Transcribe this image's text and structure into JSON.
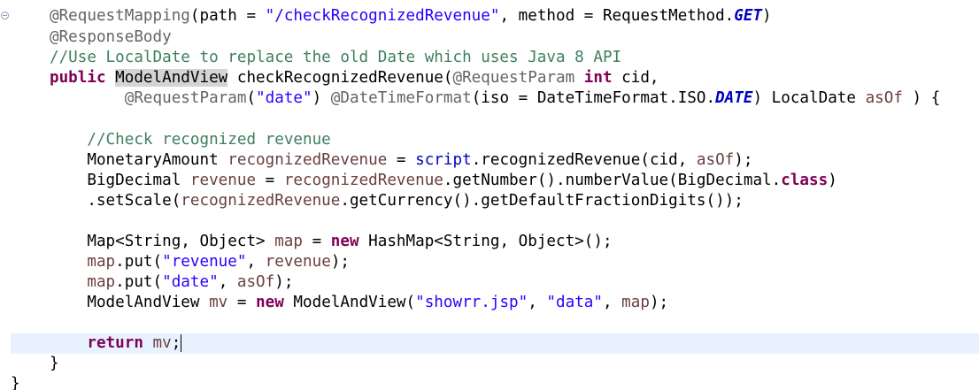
{
  "editor": {
    "language": "java",
    "current_line_index": 16,
    "lines": [
      [
        {
          "t": "@RequestMapping",
          "c": "ann"
        },
        {
          "t": "(path = ",
          "c": "sem"
        },
        {
          "t": "\"/checkRecognizedRevenue\"",
          "c": "str"
        },
        {
          "t": ", method = RequestMethod.",
          "c": "sem"
        },
        {
          "t": "GET",
          "c": "const"
        },
        {
          "t": ")",
          "c": "sem"
        }
      ],
      [
        {
          "t": "@ResponseBody",
          "c": "ann"
        }
      ],
      [
        {
          "t": "//Use LocalDate to replace the old Date which uses Java 8 API",
          "c": "cmt"
        }
      ],
      [
        {
          "t": "public",
          "c": "kw"
        },
        {
          "t": " ",
          "c": "sem"
        },
        {
          "t": "ModelAndView",
          "c": "hl"
        },
        {
          "t": " checkRecognizedRevenue(",
          "c": "sem"
        },
        {
          "t": "@RequestParam",
          "c": "ann"
        },
        {
          "t": " ",
          "c": "sem"
        },
        {
          "t": "int",
          "c": "kw"
        },
        {
          "t": " cid,",
          "c": "sem"
        }
      ],
      [
        {
          "t": "        ",
          "c": "sem"
        },
        {
          "t": "@RequestParam",
          "c": "ann"
        },
        {
          "t": "(",
          "c": "sem"
        },
        {
          "t": "\"date\"",
          "c": "str"
        },
        {
          "t": ") ",
          "c": "sem"
        },
        {
          "t": "@DateTimeFormat",
          "c": "ann"
        },
        {
          "t": "(iso = DateTimeFormat.ISO.",
          "c": "sem"
        },
        {
          "t": "DATE",
          "c": "const"
        },
        {
          "t": ") LocalDate ",
          "c": "sem"
        },
        {
          "t": "asOf",
          "c": "var"
        },
        {
          "t": " ) {",
          "c": "sem"
        }
      ],
      [],
      [
        {
          "t": "    ",
          "c": "sem"
        },
        {
          "t": "//Check recognized revenue",
          "c": "cmt"
        }
      ],
      [
        {
          "t": "    MonetaryAmount ",
          "c": "sem"
        },
        {
          "t": "recognizedRevenue",
          "c": "var"
        },
        {
          "t": " = ",
          "c": "sem"
        },
        {
          "t": "script",
          "c": "fld"
        },
        {
          "t": ".recognizedRevenue(cid, ",
          "c": "sem"
        },
        {
          "t": "asOf",
          "c": "var"
        },
        {
          "t": ");",
          "c": "sem"
        }
      ],
      [
        {
          "t": "    BigDecimal ",
          "c": "sem"
        },
        {
          "t": "revenue",
          "c": "var"
        },
        {
          "t": " = ",
          "c": "sem"
        },
        {
          "t": "recognizedRevenue",
          "c": "var"
        },
        {
          "t": ".getNumber().numberValue(BigDecimal.",
          "c": "sem"
        },
        {
          "t": "class",
          "c": "kw"
        },
        {
          "t": ")",
          "c": "sem"
        }
      ],
      [
        {
          "t": "    .setScale(",
          "c": "sem"
        },
        {
          "t": "recognizedRevenue",
          "c": "var"
        },
        {
          "t": ".getCurrency().getDefaultFractionDigits());",
          "c": "sem"
        }
      ],
      [],
      [
        {
          "t": "    Map<String, Object> ",
          "c": "sem"
        },
        {
          "t": "map",
          "c": "var"
        },
        {
          "t": " = ",
          "c": "sem"
        },
        {
          "t": "new",
          "c": "kw"
        },
        {
          "t": " HashMap<String, Object>();",
          "c": "sem"
        }
      ],
      [
        {
          "t": "    ",
          "c": "sem"
        },
        {
          "t": "map",
          "c": "var"
        },
        {
          "t": ".put(",
          "c": "sem"
        },
        {
          "t": "\"revenue\"",
          "c": "str"
        },
        {
          "t": ", ",
          "c": "sem"
        },
        {
          "t": "revenue",
          "c": "var"
        },
        {
          "t": ");",
          "c": "sem"
        }
      ],
      [
        {
          "t": "    ",
          "c": "sem"
        },
        {
          "t": "map",
          "c": "var"
        },
        {
          "t": ".put(",
          "c": "sem"
        },
        {
          "t": "\"date\"",
          "c": "str"
        },
        {
          "t": ", ",
          "c": "sem"
        },
        {
          "t": "asOf",
          "c": "var"
        },
        {
          "t": ");",
          "c": "sem"
        }
      ],
      [
        {
          "t": "    ModelAndView ",
          "c": "sem"
        },
        {
          "t": "mv",
          "c": "var"
        },
        {
          "t": " = ",
          "c": "sem"
        },
        {
          "t": "new",
          "c": "kw"
        },
        {
          "t": " ModelAndView(",
          "c": "sem"
        },
        {
          "t": "\"showrr.jsp\"",
          "c": "str"
        },
        {
          "t": ", ",
          "c": "sem"
        },
        {
          "t": "\"data\"",
          "c": "str"
        },
        {
          "t": ", ",
          "c": "sem"
        },
        {
          "t": "map",
          "c": "var"
        },
        {
          "t": ");",
          "c": "sem"
        }
      ],
      [],
      [
        {
          "t": "    ",
          "c": "sem"
        },
        {
          "t": "return",
          "c": "kw"
        },
        {
          "t": " ",
          "c": "sem"
        },
        {
          "t": "mv",
          "c": "var"
        },
        {
          "t": ";",
          "c": "sem"
        }
      ],
      [
        {
          "t": "}",
          "c": "sem"
        }
      ],
      [
        {
          "t": "}",
          "c": "sem"
        }
      ]
    ]
  },
  "colors": {
    "annotation": "#646464",
    "string": "#2a00ff",
    "comment": "#3f7f5f",
    "keyword": "#7f0055",
    "field": "#0000c0",
    "local_variable": "#6a3e3e",
    "current_line": "#e8f2fe",
    "occurrence_highlight": "#d4d4d4"
  },
  "icons": {
    "gutter_fold": "fold-collapse-icon"
  }
}
